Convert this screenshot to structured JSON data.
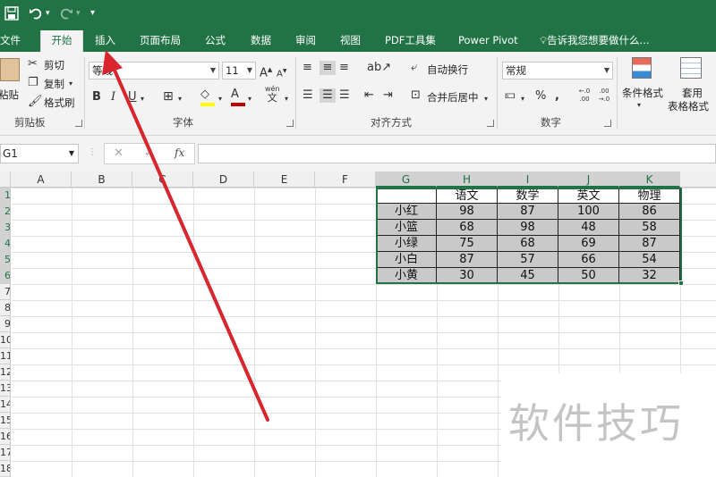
{
  "quick_access": {
    "save_icon": "save-icon",
    "undo_icon": "undo-icon",
    "redo_icon": "redo-icon",
    "customize_icon": "customize-icon"
  },
  "tabs": [
    {
      "label": "文件"
    },
    {
      "label": "开始",
      "active": true
    },
    {
      "label": "插入"
    },
    {
      "label": "页面布局"
    },
    {
      "label": "公式"
    },
    {
      "label": "数据"
    },
    {
      "label": "审阅"
    },
    {
      "label": "视图"
    },
    {
      "label": "PDF工具集"
    },
    {
      "label": "Power Pivot"
    }
  ],
  "tell_me": "告诉我您想要做什么...",
  "clipboard": {
    "paste": "粘贴",
    "cut": "剪切",
    "copy": "复制",
    "format_painter": "格式刷",
    "group": "剪贴板"
  },
  "font": {
    "name": "等线",
    "size": "11",
    "bold": "B",
    "italic": "I",
    "underline": "U",
    "grow": "A",
    "shrink": "A",
    "color_letter": "A",
    "wen": "wén",
    "wen_char": "文",
    "group": "字体"
  },
  "alignment": {
    "wrap": "自动换行",
    "merge": "合并后居中",
    "group": "对齐方式"
  },
  "number": {
    "format": "常规",
    "percent": "%",
    "comma": ",",
    "inc_decimal": "←.0 .00",
    "dec_decimal": ".00 →.0",
    "group": "数字"
  },
  "styles": {
    "conditional": "条件格式",
    "table_format_1": "套用",
    "table_format_2": "表格格式"
  },
  "formula_bar": {
    "name_box": "G1",
    "cancel": "✕",
    "enter": "✓",
    "fx": "fx",
    "value": ""
  },
  "columns": [
    "A",
    "B",
    "C",
    "D",
    "E",
    "F",
    "G",
    "H",
    "I",
    "J",
    "K"
  ],
  "rows": [
    "1",
    "2",
    "3",
    "4",
    "5",
    "6",
    "7",
    "8",
    "9",
    "10",
    "11",
    "12",
    "13",
    "14",
    "15",
    "16",
    "17",
    "18"
  ],
  "table": {
    "headers": [
      "",
      "语文",
      "数学",
      "英文",
      "物理"
    ],
    "rows": [
      [
        "小红",
        "98",
        "87",
        "100",
        "86"
      ],
      [
        "小篮",
        "68",
        "98",
        "48",
        "58"
      ],
      [
        "小绿",
        "75",
        "68",
        "69",
        "87"
      ],
      [
        "小白",
        "87",
        "57",
        "66",
        "54"
      ],
      [
        "小黄",
        "30",
        "45",
        "50",
        "32"
      ]
    ]
  },
  "watermark": "软件技巧",
  "colors": {
    "excel_green": "#217346",
    "arrow_red": "#d9262e",
    "cell_fill": "#c9c9c9",
    "font_highlight": "#ffff00",
    "font_color": "#c00000"
  }
}
